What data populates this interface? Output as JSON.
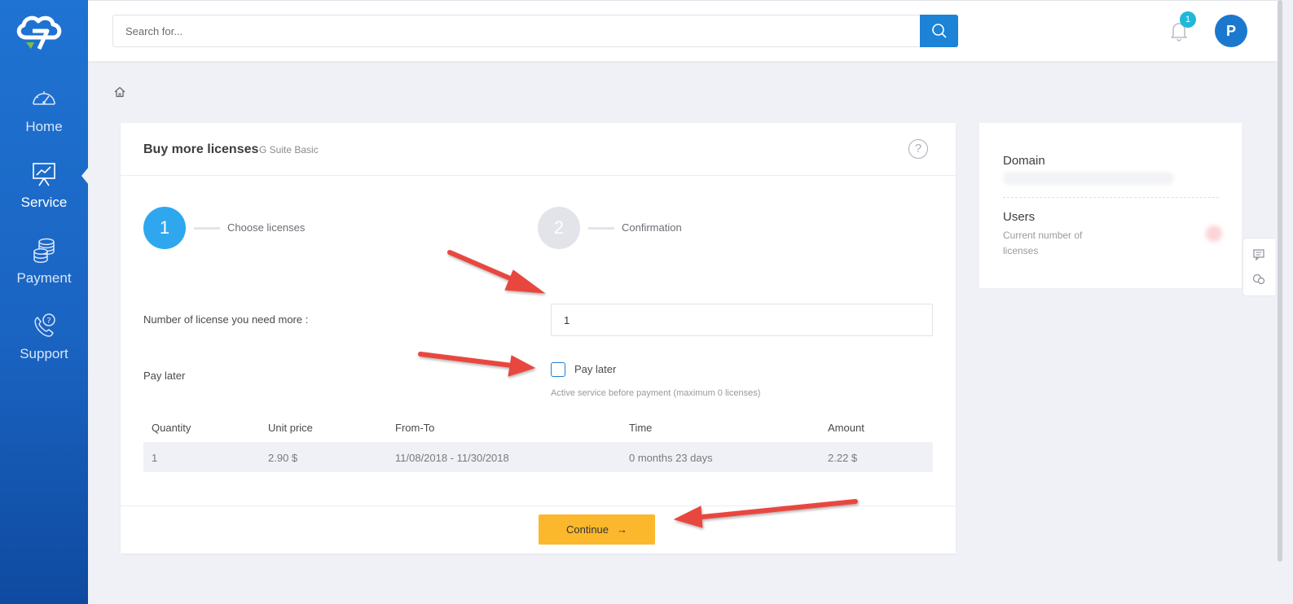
{
  "sidebar": {
    "items": [
      {
        "label": "Home",
        "icon": "speedometer-icon"
      },
      {
        "label": "Service",
        "icon": "presentation-chart-icon"
      },
      {
        "label": "Payment",
        "icon": "coins-icon"
      },
      {
        "label": "Support",
        "icon": "phone-help-icon"
      }
    ],
    "active": "Service"
  },
  "topbar": {
    "search_placeholder": "Search for...",
    "notification_count": "1",
    "avatar_initial": "P"
  },
  "card": {
    "title": "Buy more licenses",
    "subtitle": "G Suite Basic",
    "help_symbol": "?",
    "steps": [
      {
        "number": "1",
        "label": "Choose licenses",
        "active": true
      },
      {
        "number": "2",
        "label": "Confirmation",
        "active": false
      }
    ],
    "quantity_label": "Number of license you need more :",
    "quantity_value": "1",
    "pay_later_label": "Pay later",
    "pay_later_checkbox_label": "Pay later",
    "pay_later_checked": false,
    "pay_later_hint": "Active service before payment (maximum 0 licenses)",
    "table": {
      "headers": [
        "Quantity",
        "Unit price",
        "From-To",
        "Time",
        "Amount"
      ],
      "rows": [
        [
          "1",
          "2.90 $",
          "11/08/2018 - 11/30/2018",
          "0 months 23 days",
          "2.22 $"
        ]
      ]
    },
    "continue_label": "Continue",
    "continue_arrow": "→"
  },
  "side_card": {
    "domain_title": "Domain",
    "users_title": "Users",
    "users_desc": "Current number of licenses"
  },
  "colors": {
    "sidebar": "#1a64c2",
    "primary": "#1c83d6",
    "step_active": "#2ea7ee",
    "continue": "#fbb82d",
    "annotation_arrow": "#e8473f"
  }
}
